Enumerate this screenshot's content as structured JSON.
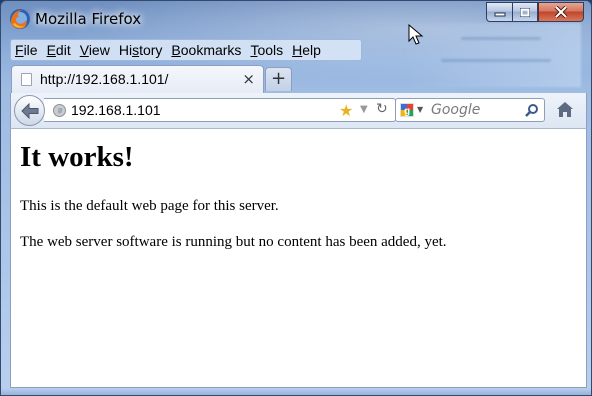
{
  "window": {
    "title": "Mozilla Firefox",
    "frame_color": "#9ebbe2"
  },
  "menu": {
    "items": [
      {
        "underline": "F",
        "rest": "ile"
      },
      {
        "underline": "E",
        "rest": "dit"
      },
      {
        "underline": "V",
        "rest": "iew"
      },
      {
        "underline": "",
        "pre": "Hi",
        "mid": "s",
        "post": "tory"
      },
      {
        "underline": "B",
        "rest": "ookmarks"
      },
      {
        "underline": "T",
        "rest": "ools"
      },
      {
        "underline": "H",
        "rest": "elp"
      }
    ]
  },
  "tabs": [
    {
      "title": "http://192.168.1.101/",
      "close": "×"
    }
  ],
  "new_tab_label": "+",
  "navbar": {
    "url": "192.168.1.101",
    "search_placeholder": "Google",
    "icons": [
      "back-arrow-icon",
      "globe-icon",
      "bookmark-star-icon",
      "dropmarker-icon",
      "reload-icon",
      "google-icon",
      "magnifier-icon",
      "home-icon"
    ]
  },
  "page": {
    "heading": "It works!",
    "paragraph1": "This is the default web page for this server.",
    "paragraph2": "The web server software is running but no content has been added, yet."
  },
  "colors": {
    "close_button": "#c1452a",
    "star": "#e6b422"
  }
}
